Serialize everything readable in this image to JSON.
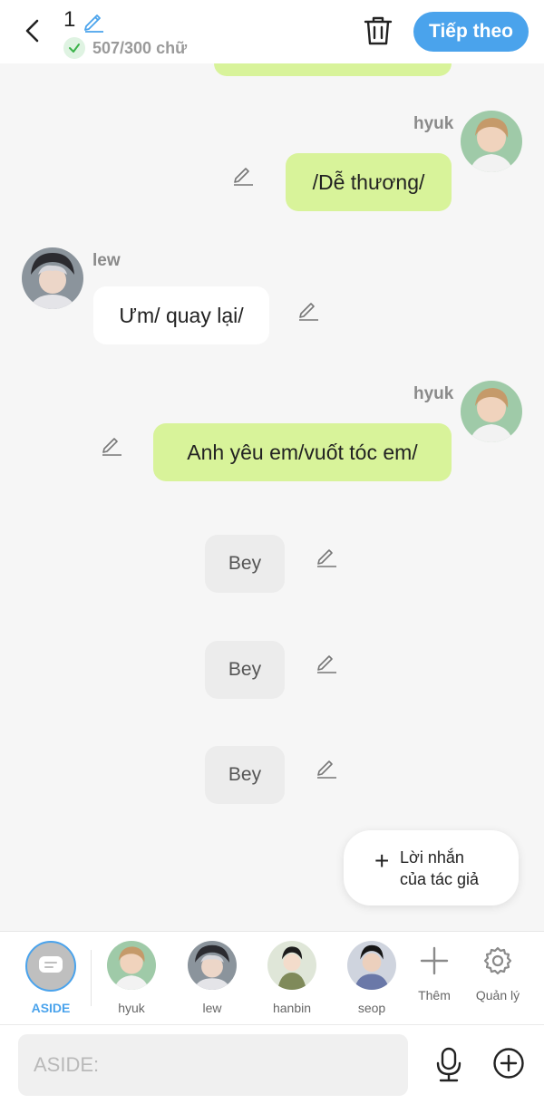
{
  "header": {
    "chapter_number": "1",
    "word_count": "507/300 chữ",
    "next_label": "Tiếp theo"
  },
  "messages": [
    {
      "sender": "hyuk",
      "side": "right",
      "text": "/Dễ thương/"
    },
    {
      "sender": "lew",
      "side": "left",
      "text": "Ưm/ quay lại/"
    },
    {
      "sender": "hyuk",
      "side": "right",
      "text": "Anh yêu em/vuốt tóc em/"
    },
    {
      "side": "aside",
      "text": "Bey"
    },
    {
      "side": "aside",
      "text": "Bey"
    },
    {
      "side": "aside",
      "text": "Bey"
    }
  ],
  "author_note": {
    "line1": "Lời nhắn",
    "line2": "của tác giả"
  },
  "characters": [
    {
      "name": "ASIDE",
      "selected": true
    },
    {
      "name": "hyuk"
    },
    {
      "name": "lew"
    },
    {
      "name": "hanbin"
    },
    {
      "name": "seop"
    }
  ],
  "tools": {
    "add_label": "Thêm",
    "manage_label": "Quản lý"
  },
  "input": {
    "placeholder": "ASIDE:"
  },
  "colors": {
    "accent": "#4aa3ec",
    "sent_bubble": "#d8f39a",
    "received_bubble": "#ffffff",
    "aside_bubble": "#ececec"
  }
}
